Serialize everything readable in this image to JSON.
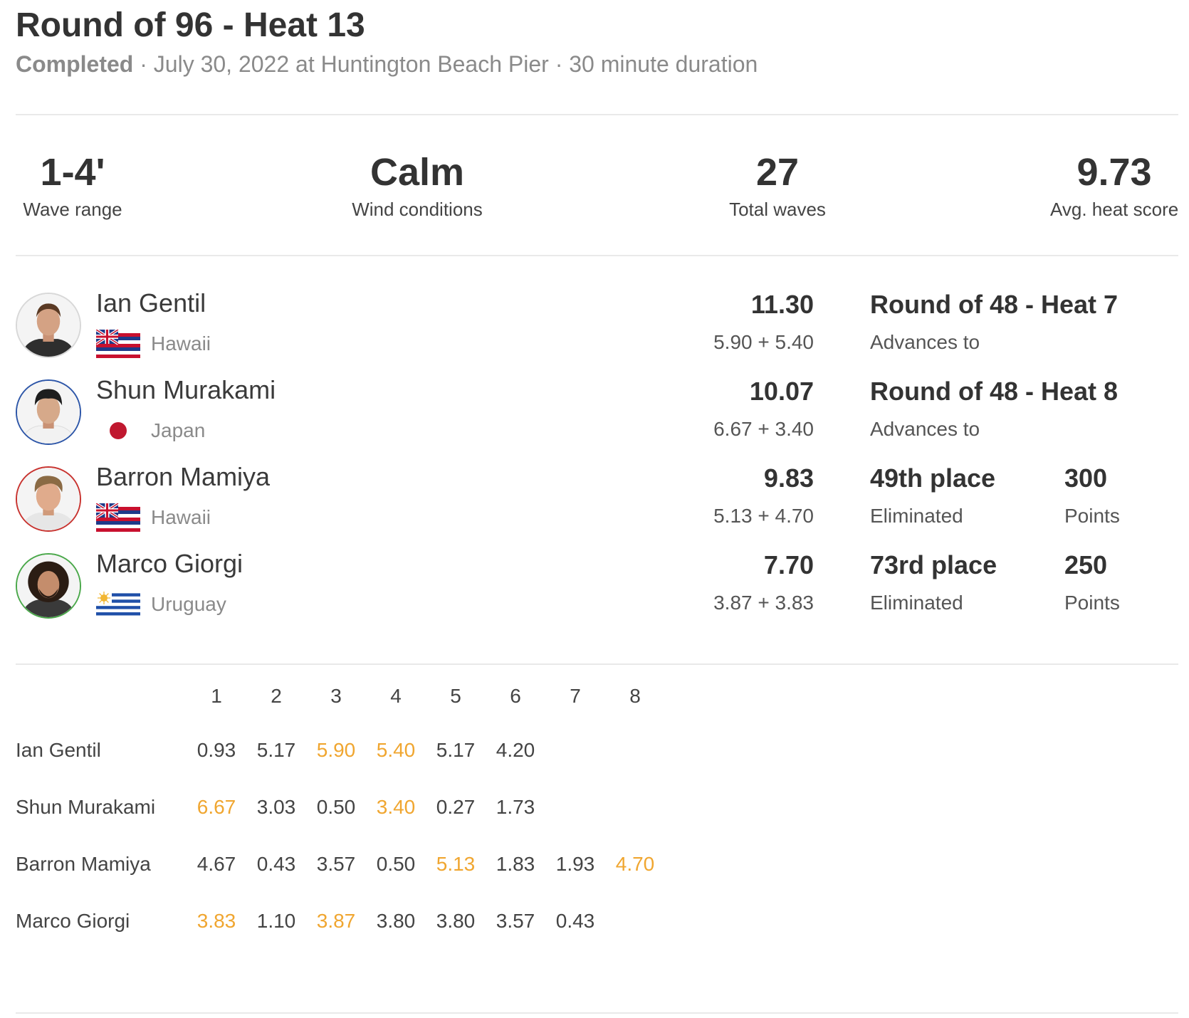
{
  "heat": {
    "title": "Round of 96 - Heat 13",
    "status": "Completed",
    "details": " · July 30, 2022 at Huntington Beach Pier · 30 minute duration"
  },
  "stats": [
    {
      "value": "1-4'",
      "label": "Wave range"
    },
    {
      "value": "Calm",
      "label": "Wind conditions"
    },
    {
      "value": "27",
      "label": "Total waves"
    },
    {
      "value": "9.73",
      "label": "Avg. heat score"
    }
  ],
  "surfers": [
    {
      "name": "Ian Gentil",
      "country": "Hawaii",
      "flag": "hawaii-flag",
      "ring": "#d8d8d8",
      "score": "11.30",
      "wave_sum": "5.90 + 5.40",
      "result": "Round of 48 - Heat 7",
      "result_sub": "Advances to"
    },
    {
      "name": "Shun Murakami",
      "country": "Japan",
      "flag": "japan-flag",
      "ring": "#2d56a8",
      "score": "10.07",
      "wave_sum": "6.67 + 3.40",
      "result": "Round of 48 - Heat 8",
      "result_sub": "Advances to"
    },
    {
      "name": "Barron Mamiya",
      "country": "Hawaii",
      "flag": "hawaii-flag",
      "ring": "#c8332f",
      "score": "9.83",
      "wave_sum": "5.13 + 4.70",
      "result": "49th place",
      "result_sub": "Eliminated",
      "points": "300",
      "points_label": "Points"
    },
    {
      "name": "Marco Giorgi",
      "country": "Uruguay",
      "flag": "uruguay-flag",
      "ring": "#4aa84a",
      "score": "7.70",
      "wave_sum": "3.87 + 3.83",
      "result": "73rd place",
      "result_sub": "Eliminated",
      "points": "250",
      "points_label": "Points"
    }
  ],
  "wave_table": {
    "headers": [
      "1",
      "2",
      "3",
      "4",
      "5",
      "6",
      "7",
      "8"
    ],
    "rows": [
      {
        "name": "Ian Gentil",
        "scores": [
          "0.93",
          "5.17",
          "5.90",
          "5.40",
          "5.17",
          "4.20"
        ],
        "best": [
          2,
          3
        ]
      },
      {
        "name": "Shun Murakami",
        "scores": [
          "6.67",
          "3.03",
          "0.50",
          "3.40",
          "0.27",
          "1.73"
        ],
        "best": [
          0,
          3
        ]
      },
      {
        "name": "Barron Mamiya",
        "scores": [
          "4.67",
          "0.43",
          "3.57",
          "0.50",
          "5.13",
          "1.83",
          "1.93",
          "4.70"
        ],
        "best": [
          4,
          7
        ]
      },
      {
        "name": "Marco Giorgi",
        "scores": [
          "3.83",
          "1.10",
          "3.87",
          "3.80",
          "3.80",
          "3.57",
          "0.43"
        ],
        "best": [
          0,
          2
        ]
      }
    ]
  },
  "colors": {
    "best_wave": "#f0a630",
    "divider": "#e9e9e9"
  }
}
